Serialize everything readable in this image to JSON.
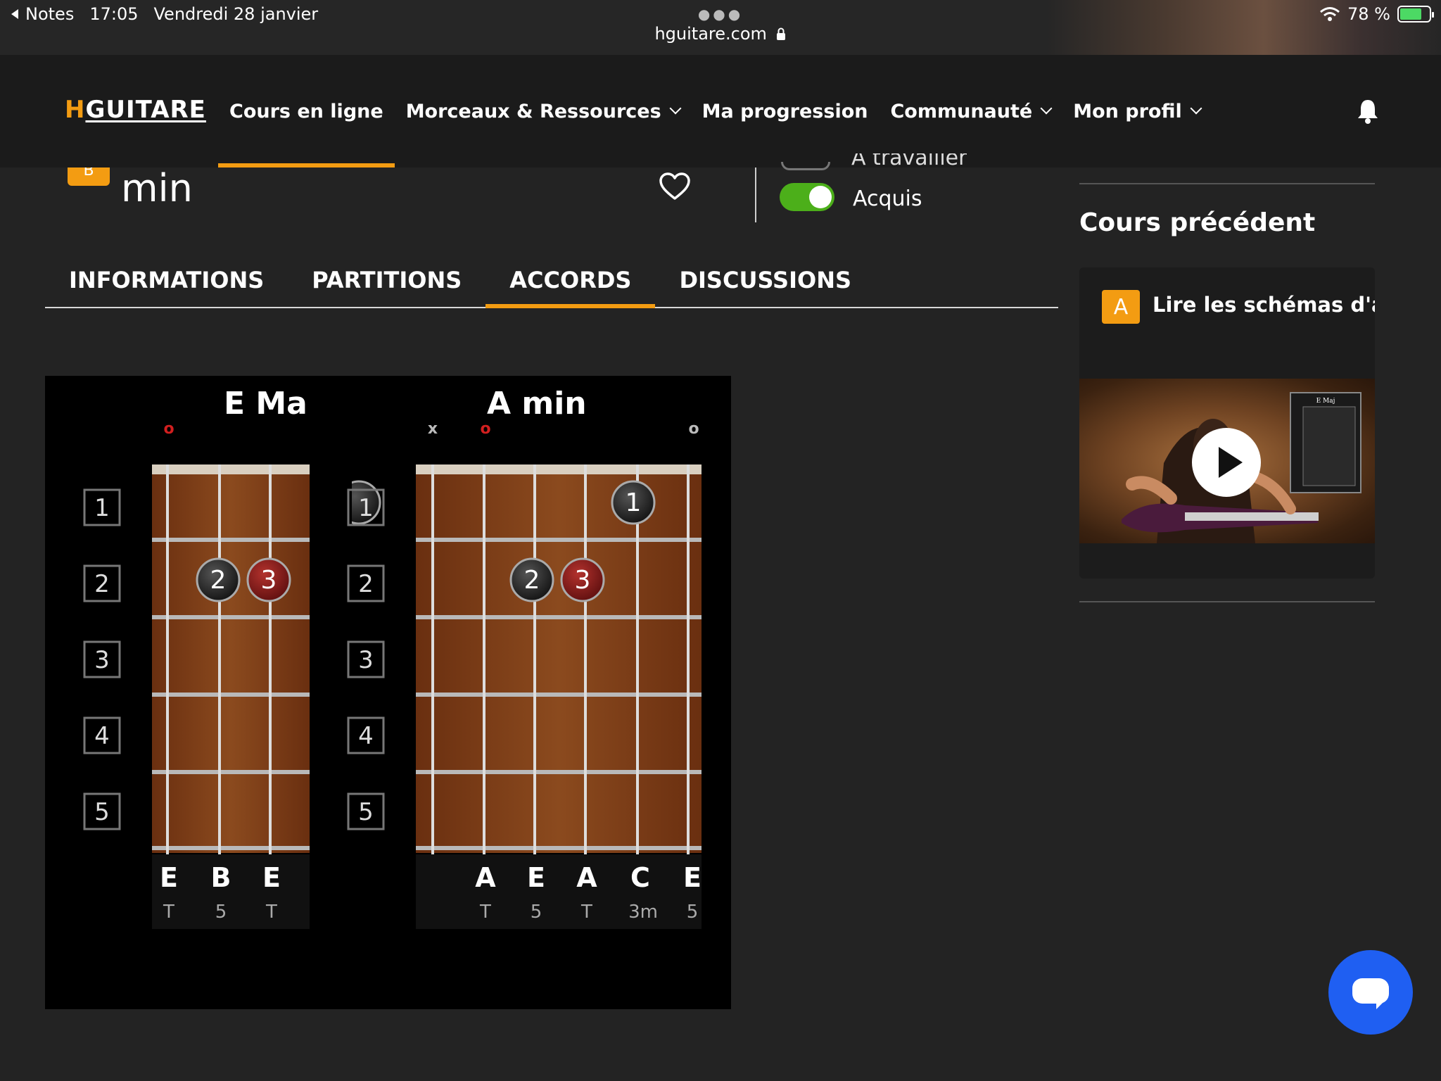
{
  "status_bar": {
    "back_app": "Notes",
    "time": "17:05",
    "date": "Vendredi 28 janvier",
    "url": "hguitare.com",
    "battery": "78 %",
    "battery_level": 0.78
  },
  "nav": {
    "logo_h": "H",
    "logo_rest": "GUITARE",
    "items": [
      {
        "label": "Cours en ligne",
        "dropdown": false,
        "active": true
      },
      {
        "label": "Morceaux & Ressources",
        "dropdown": true
      },
      {
        "label": "Ma progression",
        "dropdown": false
      },
      {
        "label": "Communauté",
        "dropdown": true
      },
      {
        "label": "Mon profil",
        "dropdown": true
      }
    ]
  },
  "lesson": {
    "badge": "B",
    "title": "min",
    "toggle_off_label": "A travailler",
    "toggle_on_label": "Acquis"
  },
  "tabs": [
    "INFORMATIONS",
    "PARTITIONS",
    "ACCORDS",
    "DISCUSSIONS"
  ],
  "active_tab": "ACCORDS",
  "chords": [
    {
      "name": "E Ma",
      "fret_numbers": [
        "1",
        "2",
        "3",
        "4",
        "5"
      ],
      "markers": [
        "o"
      ],
      "fingers": [
        "2",
        "3"
      ],
      "notes": [
        "E",
        "B",
        "E"
      ],
      "intervals": [
        "T",
        "5",
        "T"
      ]
    },
    {
      "name": "A min",
      "fret_numbers": [
        "1",
        "2",
        "3",
        "4",
        "5"
      ],
      "markers": [
        "x",
        "o",
        "o"
      ],
      "fingers": [
        "1",
        "2",
        "3"
      ],
      "notes": [
        "A",
        "E",
        "A",
        "C",
        "E"
      ],
      "intervals": [
        "T",
        "5",
        "T",
        "3m",
        "5"
      ]
    }
  ],
  "sidebar": {
    "prev_title": "Cours précédent",
    "prev_badge": "A",
    "prev_label": "Lire les schémas d'accords",
    "thumb_label": "E Maj"
  },
  "colors": {
    "accent": "#f39c12",
    "toggle_on": "#4caf1a",
    "chat": "#1f5ff2",
    "finger_red": "#8e1b1b"
  }
}
